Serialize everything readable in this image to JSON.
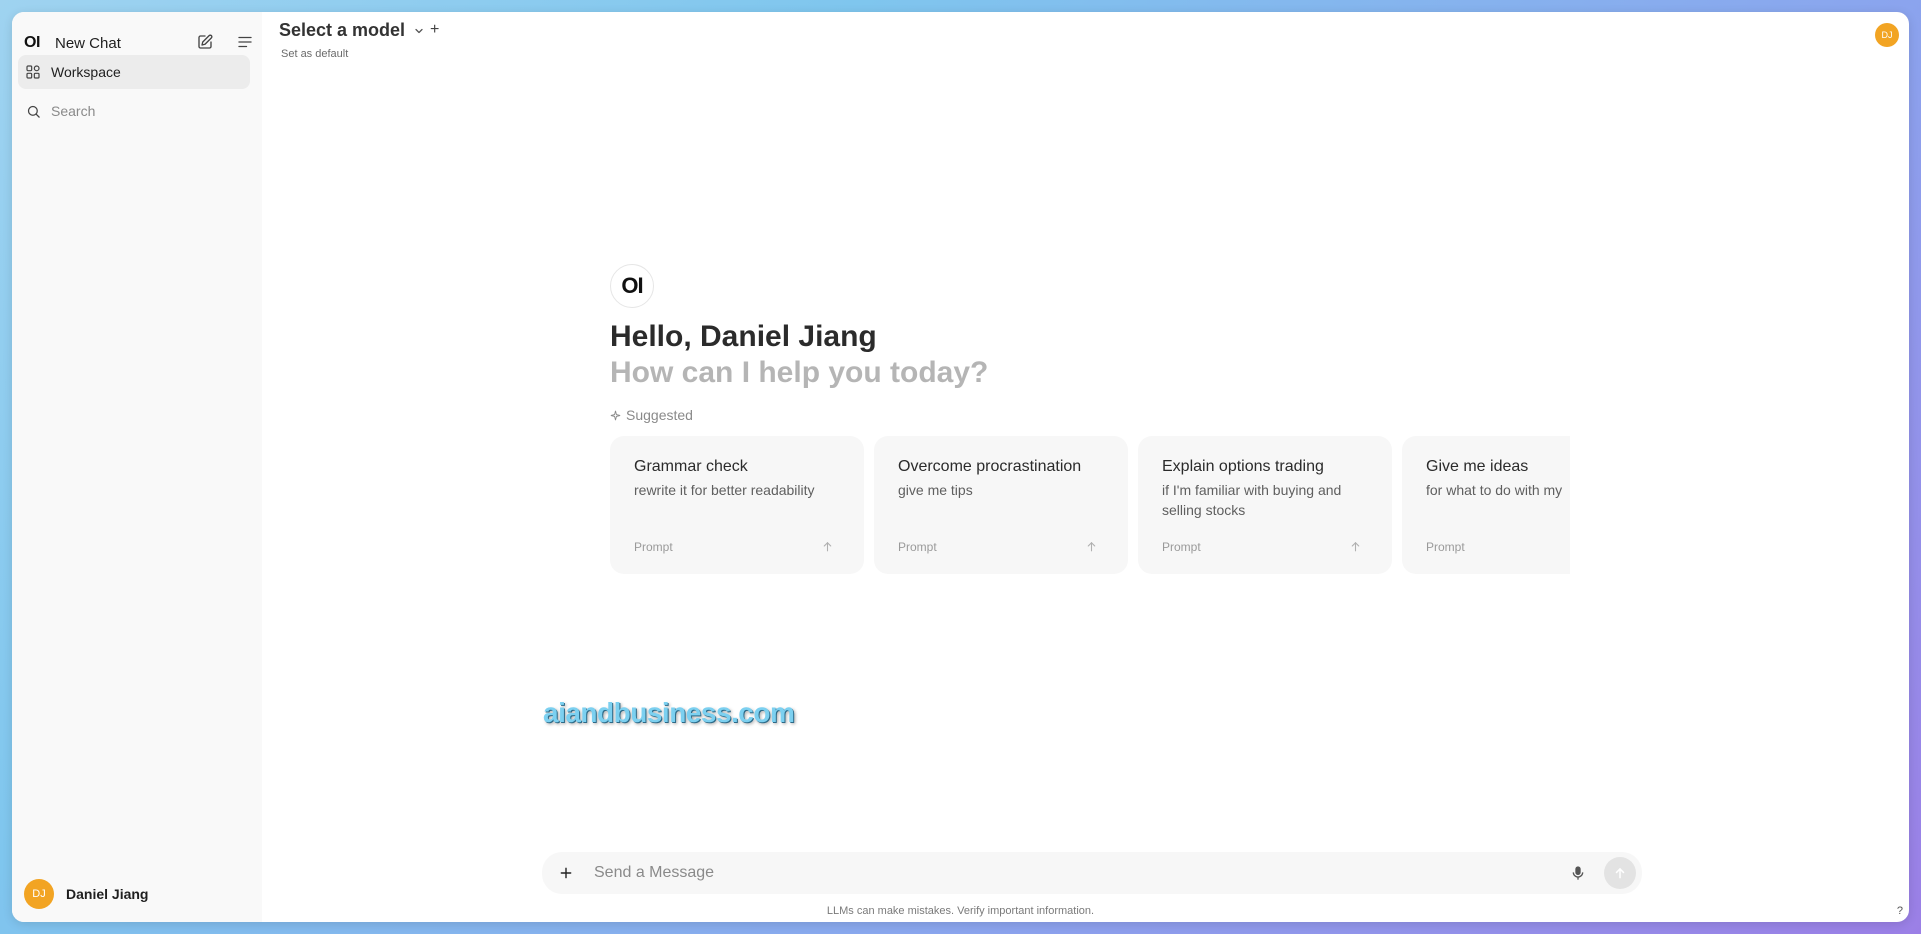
{
  "sidebar": {
    "logo": "OI",
    "new_chat_label": "New Chat",
    "workspace_label": "Workspace",
    "search_placeholder": "Search",
    "user": {
      "initials": "DJ",
      "name": "Daniel Jiang"
    }
  },
  "header": {
    "model_title": "Select a model",
    "add_symbol": "+",
    "set_default": "Set as default",
    "avatar_initials": "DJ"
  },
  "hero": {
    "logo": "OI",
    "greeting": "Hello, Daniel Jiang",
    "subtitle": "How can I help you today?",
    "suggested_label": "Suggested"
  },
  "suggestions": [
    {
      "title": "Grammar check",
      "subtitle": "rewrite it for better readability",
      "tag": "Prompt"
    },
    {
      "title": "Overcome procrastination",
      "subtitle": "give me tips",
      "tag": "Prompt"
    },
    {
      "title": "Explain options trading",
      "subtitle": "if I'm familiar with buying and selling stocks",
      "tag": "Prompt"
    },
    {
      "title": "Give me ideas",
      "subtitle": "for what to do with my",
      "tag": "Prompt"
    }
  ],
  "watermark": "aiandbusiness.com",
  "composer": {
    "placeholder": "Send a Message",
    "disclaimer": "LLMs can make mistakes. Verify important information.",
    "help": "?"
  },
  "colors": {
    "avatar": "#f2a423",
    "sidebar_bg": "#f9f9f9",
    "card_bg": "#f7f7f7"
  }
}
